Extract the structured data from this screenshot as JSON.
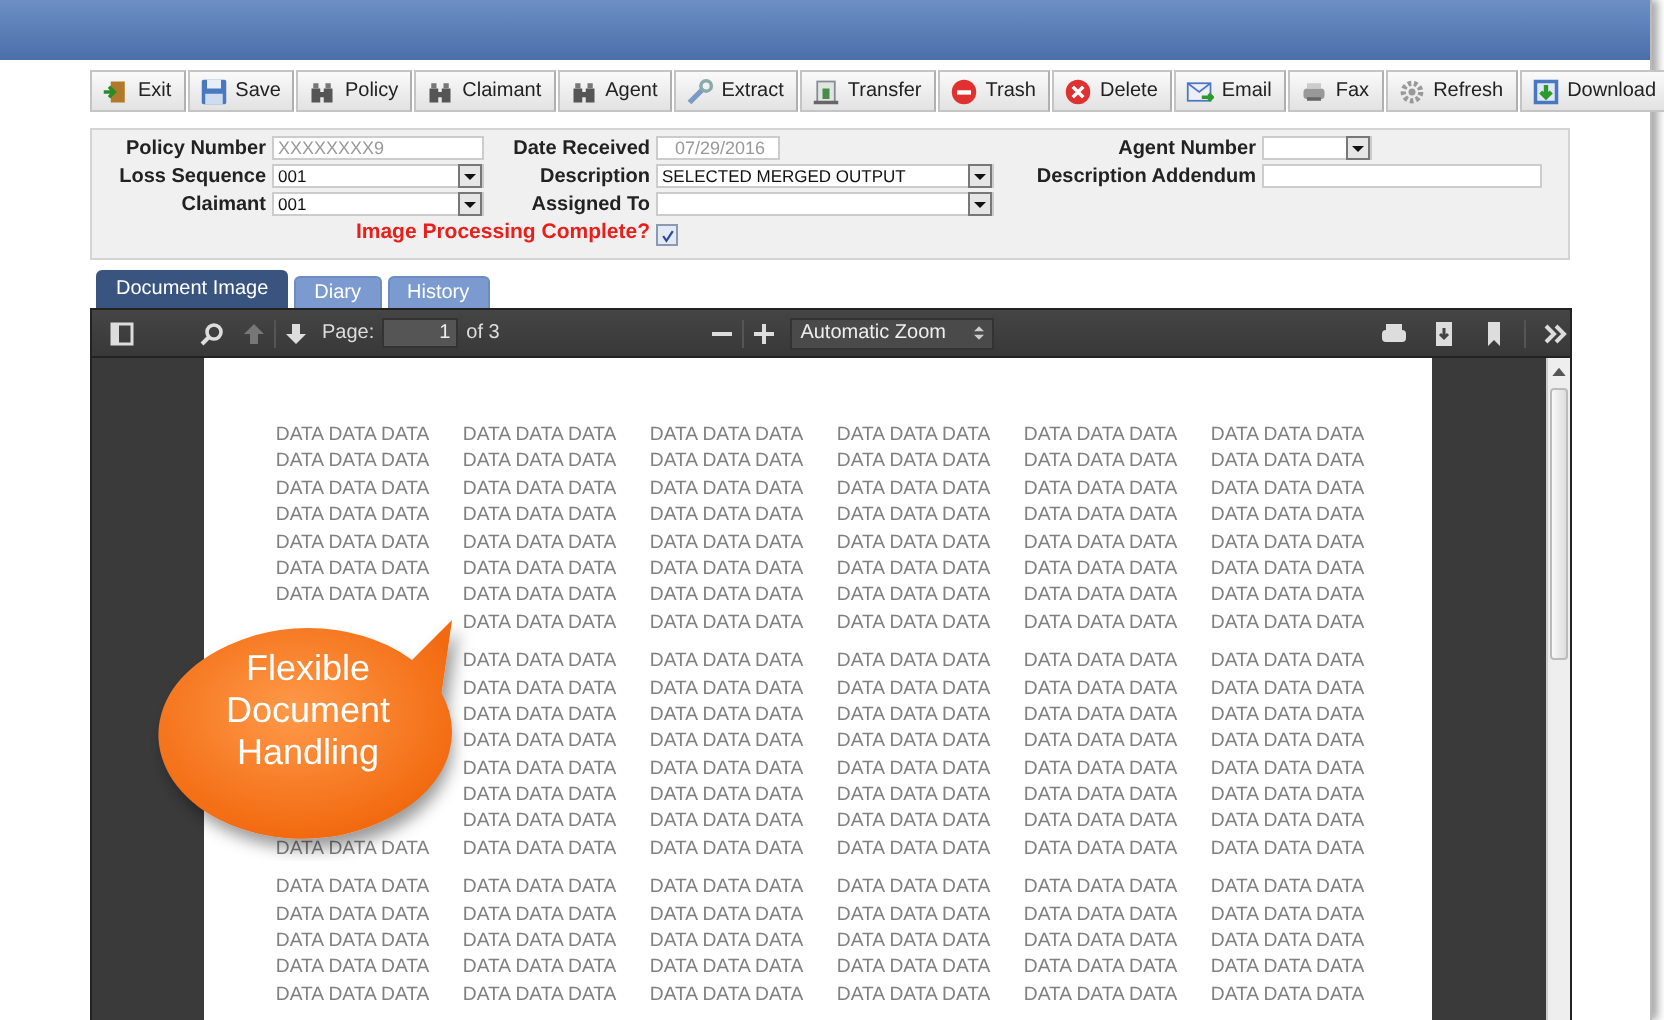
{
  "toolbar": {
    "buttons": [
      {
        "label": "Exit"
      },
      {
        "label": "Save"
      },
      {
        "label": "Policy"
      },
      {
        "label": "Claimant"
      },
      {
        "label": "Agent"
      },
      {
        "label": "Extract"
      },
      {
        "label": "Transfer"
      },
      {
        "label": "Trash"
      },
      {
        "label": "Delete"
      },
      {
        "label": "Email"
      },
      {
        "label": "Fax"
      },
      {
        "label": "Refresh"
      },
      {
        "label": "Download"
      }
    ]
  },
  "form": {
    "rows": [
      [
        {
          "label": "Policy Number",
          "kind": "text",
          "value": "XXXXXXXX9"
        },
        {
          "label": "Date Received",
          "kind": "readonly",
          "value": "07/29/2016"
        },
        {
          "label": "Agent Number",
          "kind": "select"
        }
      ],
      [
        {
          "label": "Loss Sequence",
          "kind": "select",
          "value": "001"
        },
        {
          "label": "Description",
          "kind": "select",
          "value": "SELECTED MERGED OUTPUT"
        },
        {
          "label": "Description Addendum",
          "kind": "text"
        }
      ],
      [
        {
          "label": "Claimant",
          "kind": "select",
          "value": "001"
        },
        {
          "label": "Assigned To",
          "kind": "select"
        }
      ]
    ],
    "check": {
      "label": "Image Processing Complete?",
      "checked": true
    }
  },
  "tabs": [
    {
      "label": "Document Image",
      "selected": true
    },
    {
      "label": "Diary",
      "selected": false
    },
    {
      "label": "History",
      "selected": false
    }
  ],
  "viewer": {
    "previous_page_disabled": true,
    "page_label": "Page:",
    "page_value": "1",
    "page_count": "of 3",
    "zoom": "Automatic Zoom",
    "groups": [
      {
        "rows": [
          [
            "DATA DATA DATA",
            "DATA DATA DATA",
            "DATA DATA DATA",
            "DATA DATA DATA",
            "DATA DATA DATA",
            "DATA DATA DATA"
          ],
          [
            "DATA DATA DATA",
            "DATA DATA DATA",
            "DATA DATA DATA",
            "DATA DATA DATA",
            "DATA DATA DATA",
            "DATA DATA DATA"
          ],
          [
            "DATA DATA DATA",
            "DATA DATA DATA",
            "DATA DATA DATA",
            "DATA DATA DATA",
            "DATA DATA DATA",
            "DATA DATA DATA"
          ],
          [
            "DATA DATA DATA",
            "DATA DATA DATA",
            "DATA DATA DATA",
            "DATA DATA DATA",
            "DATA DATA DATA",
            "DATA DATA DATA"
          ],
          [
            "DATA DATA DATA",
            "DATA DATA DATA",
            "DATA DATA DATA",
            "DATA DATA DATA",
            "DATA DATA DATA",
            "DATA DATA DATA"
          ],
          [
            "DATA DATA DATA",
            "DATA DATA DATA",
            "DATA DATA DATA",
            "DATA DATA DATA",
            "DATA DATA DATA",
            "DATA DATA DATA"
          ],
          [
            "DATA DATA DATA",
            "DATA DATA DATA",
            "DATA DATA DATA",
            "DATA DATA DATA",
            "DATA DATA DATA",
            "DATA DATA DATA"
          ],
          [
            null,
            "DATA DATA DATA",
            "DATA DATA DATA",
            "DATA DATA DATA",
            "DATA DATA DATA",
            "DATA DATA DATA"
          ]
        ]
      },
      {
        "rows": [
          [
            null,
            "DATA DATA DATA",
            "DATA DATA DATA",
            "DATA DATA DATA",
            "DATA DATA DATA",
            "DATA DATA DATA"
          ],
          [
            null,
            "DATA DATA DATA",
            "DATA DATA DATA",
            "DATA DATA DATA",
            "DATA DATA DATA",
            "DATA DATA DATA"
          ],
          [
            null,
            "DATA DATA DATA",
            "DATA DATA DATA",
            "DATA DATA DATA",
            "DATA DATA DATA",
            "DATA DATA DATA"
          ],
          [
            null,
            "DATA DATA DATA",
            "DATA DATA DATA",
            "DATA DATA DATA",
            "DATA DATA DATA",
            "DATA DATA DATA"
          ],
          [
            null,
            "DATA DATA DATA",
            "DATA DATA DATA",
            "DATA DATA DATA",
            "DATA DATA DATA",
            "DATA DATA DATA"
          ],
          [
            null,
            "DATA DATA DATA",
            "DATA DATA DATA",
            "DATA DATA DATA",
            "DATA DATA DATA",
            "DATA DATA DATA"
          ],
          [
            null,
            "DATA DATA DATA",
            "DATA DATA DATA",
            "DATA DATA DATA",
            "DATA DATA DATA",
            "DATA DATA DATA"
          ],
          [
            "DATA DATA DATA",
            "DATA DATA DATA",
            "DATA DATA DATA",
            "DATA DATA DATA",
            "DATA DATA DATA",
            "DATA DATA DATA"
          ]
        ]
      },
      {
        "rows": [
          [
            "DATA DATA DATA",
            "DATA DATA DATA",
            "DATA DATA DATA",
            "DATA DATA DATA",
            "DATA DATA DATA",
            "DATA DATA DATA"
          ],
          [
            "DATA DATA DATA",
            "DATA DATA DATA",
            "DATA DATA DATA",
            "DATA DATA DATA",
            "DATA DATA DATA",
            "DATA DATA DATA"
          ],
          [
            "DATA DATA DATA",
            "DATA DATA DATA",
            "DATA DATA DATA",
            "DATA DATA DATA",
            "DATA DATA DATA",
            "DATA DATA DATA"
          ],
          [
            "DATA DATA DATA",
            "DATA DATA DATA",
            "DATA DATA DATA",
            "DATA DATA DATA",
            "DATA DATA DATA",
            "DATA DATA DATA"
          ],
          [
            "DATA DATA DATA",
            "DATA DATA DATA",
            "DATA DATA DATA",
            "DATA DATA DATA",
            "DATA DATA DATA",
            "DATA DATA DATA"
          ]
        ]
      }
    ]
  },
  "callout": {
    "text": "Flexible Document Handling"
  }
}
